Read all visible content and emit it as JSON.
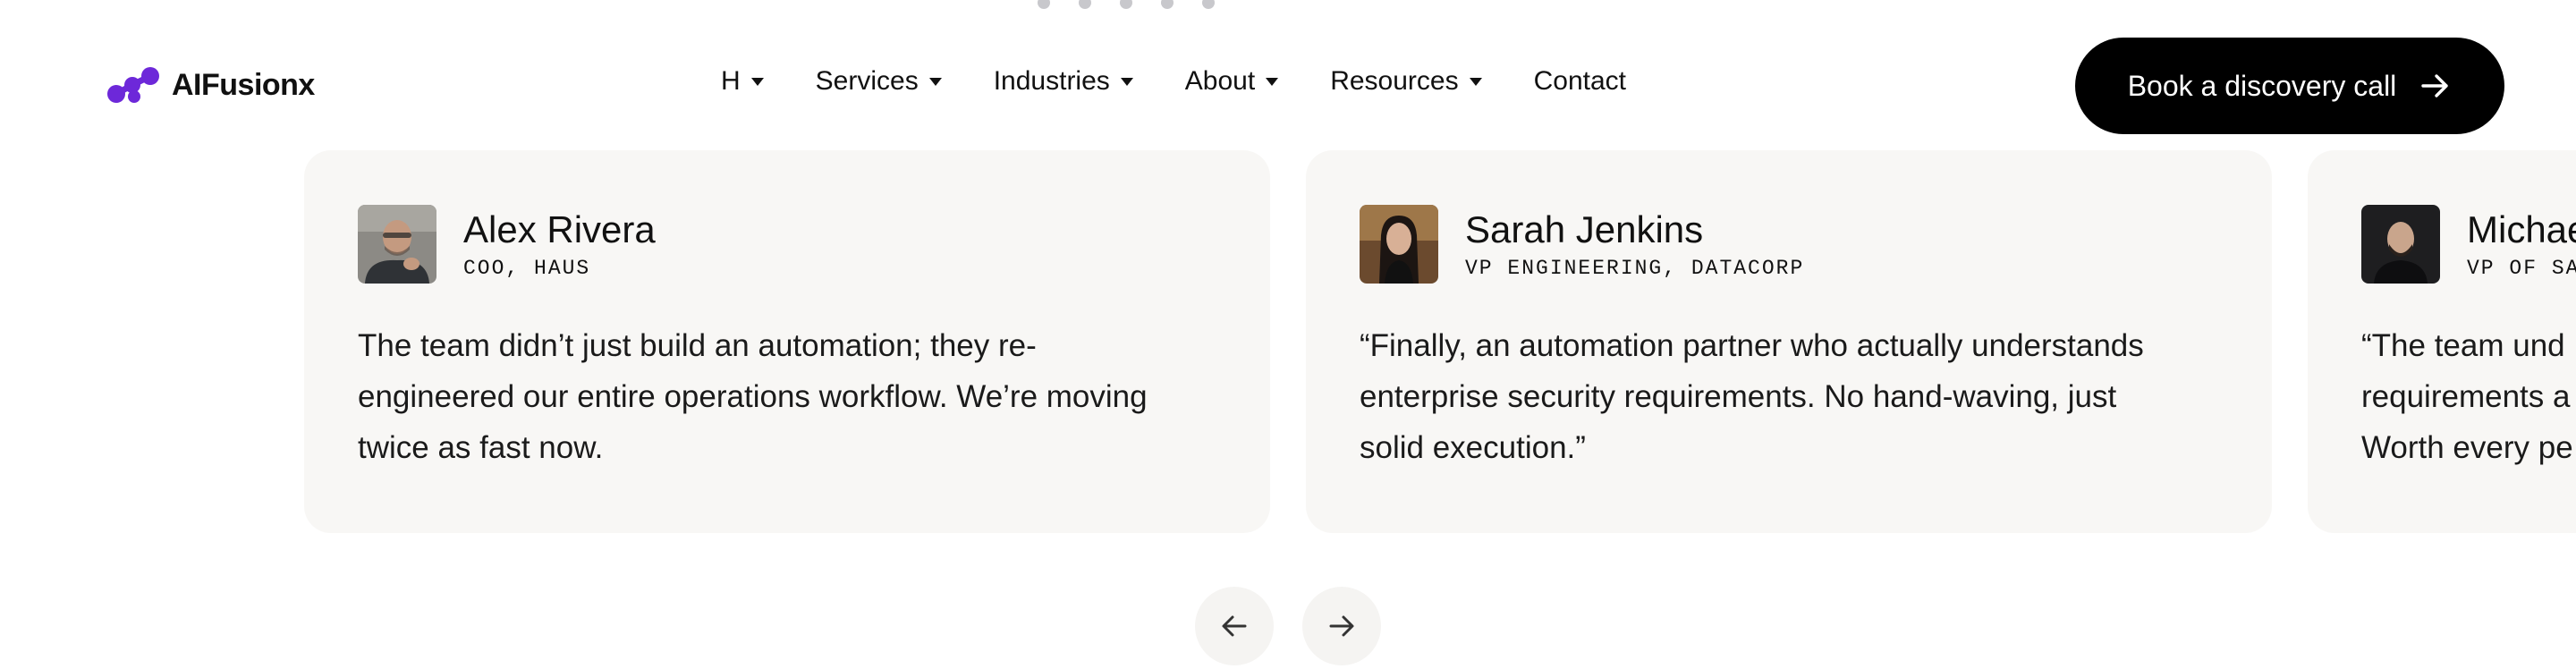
{
  "header": {
    "logo_text": "AIFusionx",
    "brand_color": "#6d28d9",
    "nav_items": [
      {
        "label": "H",
        "has_dropdown": true
      },
      {
        "label": "Services",
        "has_dropdown": true
      },
      {
        "label": "Industries",
        "has_dropdown": true
      },
      {
        "label": "About",
        "has_dropdown": true
      },
      {
        "label": "Resources",
        "has_dropdown": true
      },
      {
        "label": "Contact",
        "has_dropdown": false
      }
    ],
    "cta_label": "Book a discovery call",
    "cta_icon": "arrow-right-icon"
  },
  "testimonials": [
    {
      "name": "Alex Rivera",
      "role": "COO, HAUS",
      "quote": "The team didn’t just build an automation; they re-engineered our entire operations workflow. We’re moving twice as fast now."
    },
    {
      "name": "Sarah Jenkins",
      "role": "VP ENGINEERING, DATACORP",
      "quote": "“Finally, an automation partner who actually understands enterprise security requirements. No hand-waving, just solid execution.”"
    },
    {
      "name": "Michae",
      "role": "VP OF SAL",
      "quote_lines": [
        "“The team und",
        "requirements a",
        "Worth every pe"
      ]
    }
  ],
  "carousel_controls": {
    "prev_icon": "arrow-left-icon",
    "next_icon": "arrow-right-icon"
  }
}
